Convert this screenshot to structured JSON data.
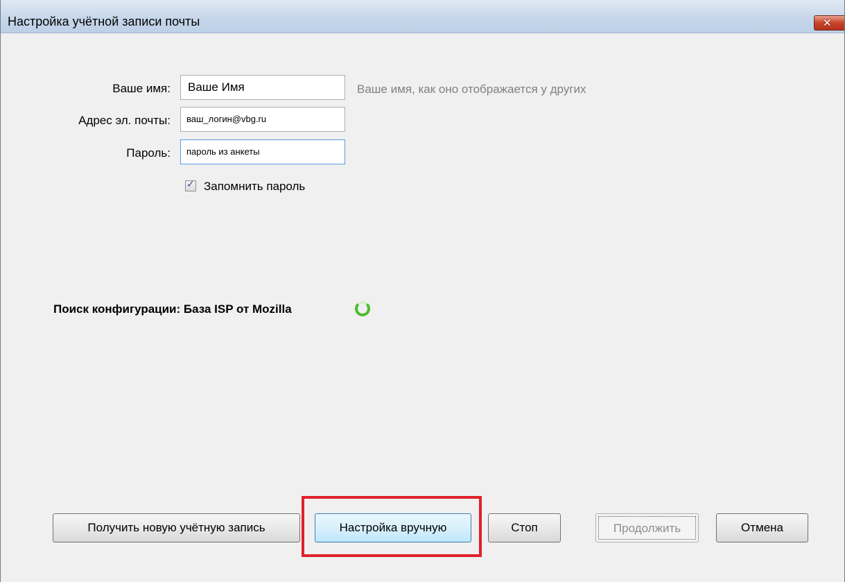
{
  "window": {
    "title": "Настройка учётной записи почты",
    "close_glyph": "✕"
  },
  "form": {
    "name_label": "Ваше имя:",
    "name_value": "Ваше Имя",
    "name_hint": "Ваше имя, как оно отображается у других",
    "email_label": "Адрес эл. почты:",
    "email_value": "ваш_логин@vbg.ru",
    "password_label": "Пароль:",
    "password_value": "пароль из анкеты",
    "remember_label": "Запомнить пароль",
    "remember_checked": true
  },
  "status": {
    "text": "Поиск конфигурации: База ISP от Mozilla",
    "spinner_color": "#4cbb2b"
  },
  "buttons": {
    "new_account": "Получить новую учётную запись",
    "manual_setup": "Настройка вручную",
    "stop": "Стоп",
    "continue": "Продолжить",
    "cancel": "Отмена"
  },
  "highlight_color": "#e0202a"
}
